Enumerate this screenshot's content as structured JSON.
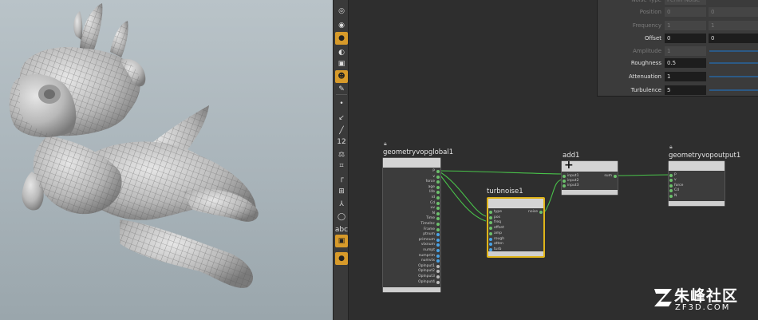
{
  "params": {
    "rows": [
      {
        "label": "Noise Type",
        "value": "Perlin Noise",
        "dim": true
      },
      {
        "label": "Position",
        "value": "0",
        "value2": "0",
        "dim": true
      },
      {
        "label": "Frequency",
        "value": "1",
        "value2": "1",
        "dim": true
      },
      {
        "label": "Offset",
        "value": "0",
        "value2": "0",
        "dim": false
      },
      {
        "label": "Amplitude",
        "value": "1",
        "dim": true
      },
      {
        "label": "Roughness",
        "value": "0.5",
        "dim": false
      },
      {
        "label": "Attenuation",
        "value": "1",
        "dim": false
      },
      {
        "label": "Turbulence",
        "value": "5",
        "dim": false
      }
    ]
  },
  "nodes": {
    "global": {
      "title": "geometryvopglobal1",
      "outputs": [
        "P",
        "v",
        "force",
        "age",
        "life",
        "id",
        "Cd",
        "uv",
        "N",
        "Time",
        "TimeInc",
        "Frame",
        "ptnum",
        "primnum",
        "vtxnum",
        "numpt",
        "numprim",
        "numvtx",
        "OpInput1",
        "OpInput2",
        "OpInput3",
        "OpInput4"
      ]
    },
    "turbnoise": {
      "title": "turbnoise1",
      "inputs": [
        "type",
        "pos",
        "freq",
        "offset",
        "amp",
        "rough",
        "atten",
        "turb"
      ],
      "outputs": [
        "noise"
      ]
    },
    "add": {
      "title": "add1",
      "inputs": [
        "input1",
        "input2",
        "input3"
      ],
      "outputs": [
        "sum"
      ]
    },
    "output": {
      "title": "geometryvopoutput1",
      "inputs": [
        "P",
        "v",
        "force",
        "Cd",
        "N"
      ]
    }
  },
  "colors": {
    "accent": "#d79a2a",
    "wire": "#49c24a",
    "port_float": "#6cc06c",
    "port_vector": "#4aa3e6",
    "port_int": "#e0c070",
    "selected_border": "#e0b419"
  },
  "watermark": {
    "cn": "朱峰社区",
    "en": "ZF3D.COM"
  },
  "toolbar": {
    "icons": [
      "toggle-icon",
      "render-icon",
      "camera-icon",
      "light-icon",
      "snapshot-icon",
      "skull-icon",
      "paint-icon",
      "transform-icon",
      "dot-icon",
      "measure-icon",
      "pipette-icon",
      "number-icon",
      "weight-icon",
      "brush-icon",
      "bracket-icon",
      "snap-icon",
      "axis-icon",
      "circle-icon",
      "text-icon",
      "record-icon",
      "pin-icon"
    ],
    "labels": {
      "number": "12",
      "text": "abc"
    }
  }
}
